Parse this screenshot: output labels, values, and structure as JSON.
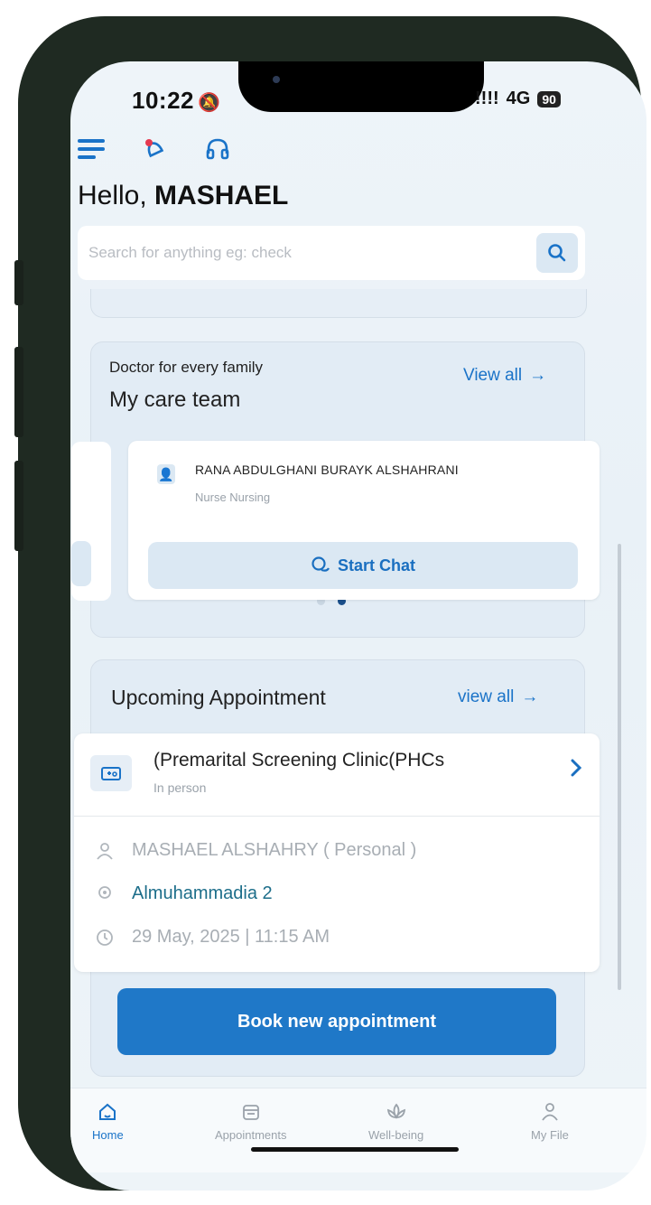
{
  "status": {
    "time": "10:22",
    "signal": "!!!!",
    "network": "4G",
    "battery": "90"
  },
  "header": {
    "greeting_prefix": "Hello, ",
    "user_name": "MASHAEL"
  },
  "search": {
    "placeholder": "Search for anything eg: check"
  },
  "care_team": {
    "subtitle": "Doctor for every family",
    "title": "My care team",
    "view_all": "View all",
    "member": {
      "name": "RANA ABDULGHANI BURAYK ALSHAHRANI",
      "role": "Nurse Nursing"
    },
    "chat_label": "Start Chat"
  },
  "appointment": {
    "title": "Upcoming Appointment",
    "view_all": "view all",
    "clinic": "(Premarital Screening Clinic(PHCs",
    "mode": "In person",
    "patient": "MASHAEL ALSHAHRY ( Personal )",
    "location": "Almuhammadia 2",
    "datetime": "29 May, 2025 | 11:15 AM",
    "book_label": "Book new appointment"
  },
  "tabs": [
    {
      "label": "Home"
    },
    {
      "label": "Appointments"
    },
    {
      "label": "Well-being"
    },
    {
      "label": "My File"
    }
  ],
  "colors": {
    "accent": "#1f78c8",
    "background": "#e9f1f7"
  }
}
